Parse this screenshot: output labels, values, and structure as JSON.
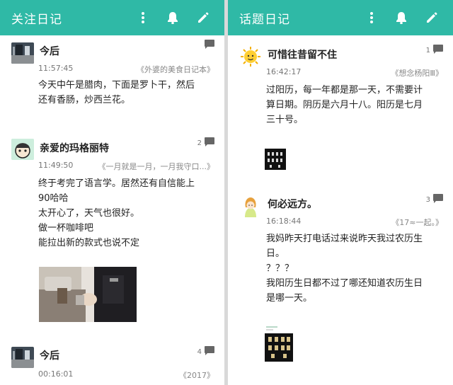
{
  "left": {
    "title": "关注日记",
    "entries": [
      {
        "author": "今后",
        "time": "11:57:45",
        "book": "《外婆的美食日记本》",
        "lines": [
          "今天中午是腊肉，下面是罗卜干，然后",
          "还有香肠，炒西兰花。"
        ]
      },
      {
        "author": "亲爱的玛格丽特",
        "comments": "2",
        "time": "11:49:50",
        "book": "《一月就是一月，一月我守口...》",
        "lines": [
          "终于考完了语言学。居然还有自信能上",
          "90哈哈",
          "太开心了，天气也很好。",
          "做一杯咖啡吧",
          "能拉出新的款式也说不定"
        ]
      },
      {
        "author": "今后",
        "comments": "4",
        "time": "00:16:01",
        "book": "《2017》"
      }
    ]
  },
  "right": {
    "title": "话题日记",
    "entries": [
      {
        "author": "可惜往昔留不住",
        "comments": "1",
        "time": "16:42:17",
        "book": "《想念杨阳Ⅲ》",
        "lines": [
          "过阳历，每一年都是那一天，不需要计",
          "算日期。阴历是六月十八。阳历是七月",
          "三十号。"
        ]
      },
      {
        "author": "何必远方。",
        "comments": "3",
        "time": "16:18:44",
        "book": "《17≈一起。》",
        "lines": [
          "我妈昨天打电话过来说昨天我过农历生",
          "日。",
          "？？？",
          "我阳历生日都不过了哪还知道农历生日",
          "是哪一天。"
        ]
      }
    ]
  },
  "icons": {
    "more": "more-vertical-icon",
    "bell": "bell-icon",
    "edit": "pencil-icon",
    "comment": "comment-icon"
  },
  "colors": {
    "appbar": "#2fb9a6",
    "appbar_text": "#ffffff"
  }
}
